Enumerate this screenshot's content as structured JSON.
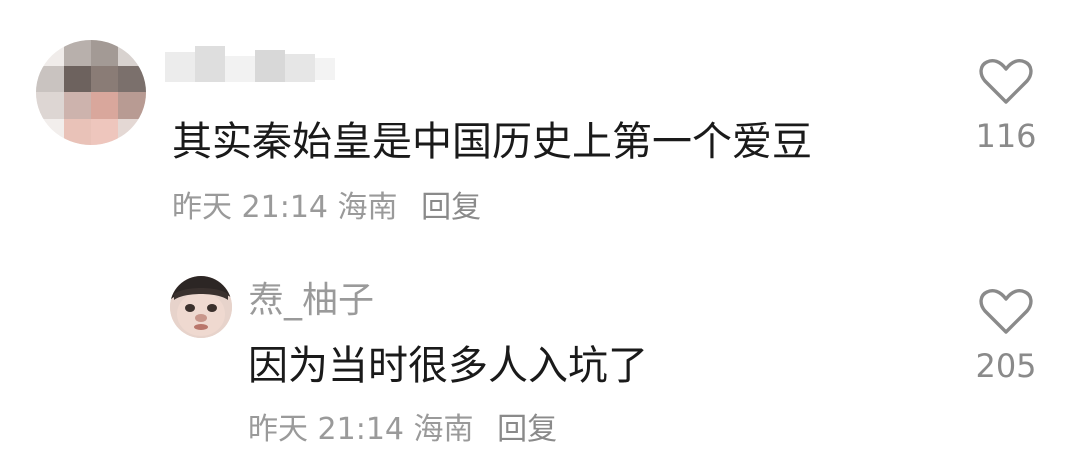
{
  "comment": {
    "text": "其实秦始皇是中国历史上第一个爱豆",
    "time": "昨天 21:14",
    "location": "海南",
    "reply_label": "回复",
    "likes": "116"
  },
  "reply": {
    "username": "焘_柚子",
    "text": "因为当时很多人入坑了",
    "time": "昨天 21:14",
    "location": "海南",
    "reply_label": "回复",
    "likes": "205"
  },
  "icons": {
    "like": "heart-outline-icon"
  },
  "colors": {
    "primary_text": "#1a1a1a",
    "secondary_text": "#9a9a9a",
    "icon": "#8a8a8a"
  }
}
